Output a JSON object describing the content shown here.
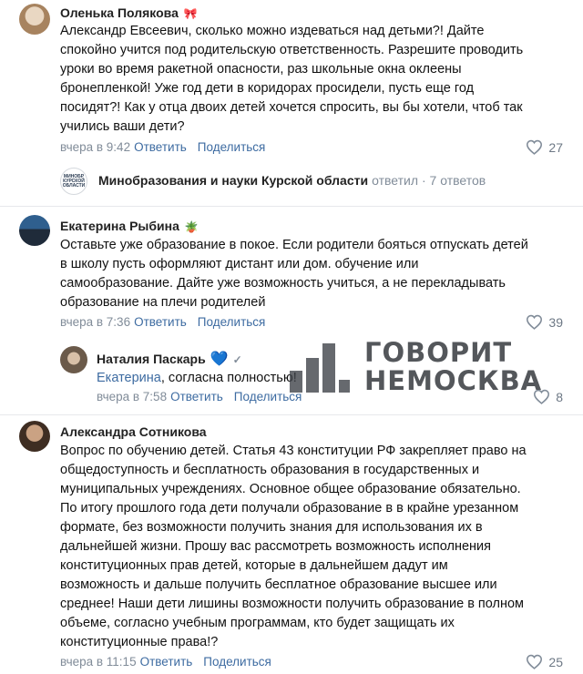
{
  "comments": [
    {
      "author": "Оленька Полякова",
      "emoji": "🎀",
      "lines": [
        "Александр Евсеевич, сколько можно издеваться над детьми?! Дайте",
        "спокойно учится под родительскую ответственность. Разрешите проводить",
        "уроки во время ракетной опасности, раз школьные окна оклеены",
        "бронепленкой! Уже год дети в коридорах просидели, пусть еще год",
        "посидят?! Как у отца двоих детей хочется спросить, вы бы хотели, чтоб так",
        "учились ваши дети?"
      ],
      "time": "вчера в 9:42",
      "reply_label": "Ответить",
      "share_label": "Поделиться",
      "likes": "27"
    },
    {
      "author": "Екатерина Рыбина",
      "emoji": "🪴",
      "lines": [
        "Оставьте уже образование в покое. Если родители бояться отпускать детей",
        "в школу пусть оформляют дистант или дом. обучение или",
        "самообразование. Дайте уже возможность учиться, а не перекладывать",
        "образование на плечи родителей"
      ],
      "time": "вчера в 7:36",
      "reply_label": "Ответить",
      "share_label": "Поделиться",
      "likes": "39"
    },
    {
      "author": "Александра Сотникова",
      "lines": [
        "Вопрос по обучению детей. Статья 43 конституции РФ закрепляет право на",
        "общедоступность и бесплатность образования в государственных и",
        "муниципальных учреждениях. Основное общее образование обязательно.",
        "По итогу прошлого года дети получали образование в в крайне урезанном",
        "формате, без возможности получить знания для использования их в",
        "дальнейшей жизни. Прошу вас рассмотреть возможность исполнения",
        "конституционных прав детей, которые в дальнейшем дадут им",
        "возможность и дальше получить бесплатное образование высшее или",
        "среднее! Наши дети лишины возможности получить образование в полном",
        "объеме, согласно учебным программам, кто будет защищать их",
        "конституционные права!?"
      ],
      "time": "вчера в 11:15",
      "reply_label": "Ответить",
      "share_label": "Поделиться",
      "likes": "25"
    }
  ],
  "org_reply": {
    "avatar_text": "МИНОБР КУРСКОЙ ОБЛАСТИ",
    "name": "Минобразования и науки Курской области",
    "action": "ответил",
    "count": "· 7 ответов"
  },
  "nested_reply": {
    "author": "Наталия Паскарь",
    "heart": "💙",
    "check": "✓",
    "mention": "Екатерина",
    "text": ", согласна полностью!",
    "time": "вчера в 7:58",
    "reply_label": "Ответить",
    "share_label": "Поделиться",
    "likes": "8"
  },
  "watermark": {
    "line1": "ГОВОРИТ",
    "line2": "НЕМОСКВА"
  },
  "colors": {
    "link": "#3d6ba1",
    "meta": "#818c99",
    "badge": "#3f8ae0"
  },
  "icons": {
    "like": "heart-outline-icon"
  }
}
